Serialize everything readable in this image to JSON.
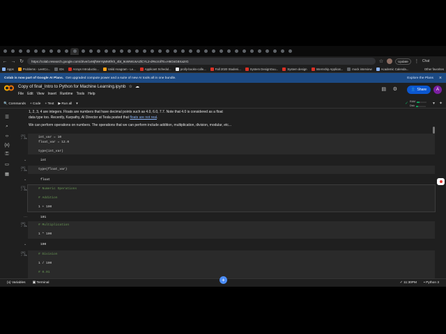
{
  "browser": {
    "url": "https://colab.research.google.com/drive/1vMjfWeYqMMtfKh_4bt_9oWWUsAZlCYL2-d#scrollTo=H6GsG8Xa2rG",
    "update_label": "Update",
    "chat_label": "Chat",
    "tab_count_visible": 38,
    "bookmarks": [
      {
        "label": "Apps",
        "color": "#8ab4f8"
      },
      {
        "label": "Problems - LeetCo...",
        "color": "#ffa116"
      },
      {
        "label": "IDs",
        "color": "#5f6368"
      },
      {
        "label": "Arrays Introductio...",
        "color": "#d93025"
      },
      {
        "label": "Valid Anagram - Le...",
        "color": "#ffa116"
      },
      {
        "label": "Applicant Schedul...",
        "color": "#d93025"
      },
      {
        "label": "prolly-books-colle...",
        "color": "#e8eaed"
      },
      {
        "label": "Fall 2020 Studeni...",
        "color": "#d93025"
      },
      {
        "label": "System DesignGuu...",
        "color": "#d93025"
      },
      {
        "label": "System design",
        "color": "#d93025"
      },
      {
        "label": "Internship Applicat...",
        "color": "#d93025"
      },
      {
        "label": "mock interview",
        "color": "#5f6368"
      },
      {
        "label": "Academic Calenda...",
        "color": "#8ab4f8"
      }
    ],
    "other_favorites": "Other favorites"
  },
  "banner": {
    "bold": "Colab is now part of Google AI Plans.",
    "text": "Get upgraded compute power and a suite of new AI tools all in one bundle.",
    "action": "Explore the Plans"
  },
  "header": {
    "title": "Copy of final_Intro to Python for Machine Learning.ipynb",
    "menu": [
      "File",
      "Edit",
      "View",
      "Insert",
      "Runtime",
      "Tools",
      "Help"
    ],
    "share": "Share",
    "user_initial": "A"
  },
  "toolbar": {
    "commands": "Commands",
    "code": "+ Code",
    "text": "+ Text",
    "run_all": "Run all",
    "ram": "RAM",
    "disk": "Disk",
    "ram_level": 0.25,
    "disk_level": 0.2
  },
  "markdown": {
    "line1": "1, 2, 3, 4 are integers. Floats are numbers that have decimal points such as 4.0, 6.0, 7.7. Note that 4.0 is considered as a float",
    "line2_pre": "data type too. Recently, Karpathy, AI Director at Tesla posted that ",
    "line2_link": "floats are not real",
    "line2_post": ".",
    "line3": "We can perform operations on numbers. The operations that we can perform include addition, multiplication, division, modular, etc..."
  },
  "cells": [
    {
      "num": "[5]\n✓ 0s",
      "code_lines": [
        "int_var = 10",
        "float_var = 12.0",
        "",
        "type(int_var)"
      ],
      "output": "int"
    },
    {
      "num": "[6]\n✓ 0s",
      "code_lines": [
        "type(float_var)"
      ],
      "output": "float"
    },
    {
      "num": "[7]\n✓ 0s",
      "code_lines": [
        "# Numeric Operations",
        "",
        "# Addition",
        "",
        "1 + 100"
      ],
      "output": "101"
    },
    {
      "num": "[8]\n✓ 0s",
      "code_lines": [
        "# Multiplication",
        "",
        "1 * 100"
      ],
      "output": "100"
    },
    {
      "num": "[9]\n✓ 0s",
      "code_lines": [
        "# Division",
        "",
        "1 / 100",
        "",
        "# 0.01"
      ],
      "output": ""
    }
  ],
  "statusbar": {
    "variables": "Variables",
    "terminal": "Terminal",
    "time": "11:30PM",
    "kernel": "Python 3"
  }
}
